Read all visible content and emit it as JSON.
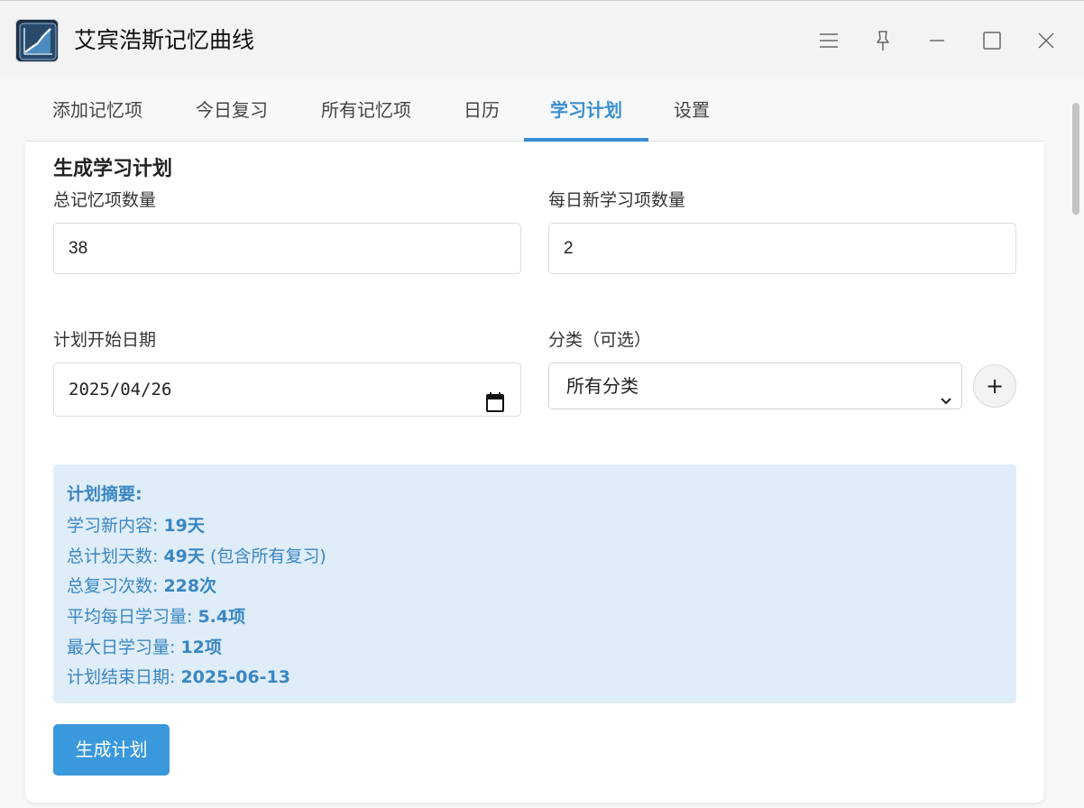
{
  "window": {
    "title": "艾宾浩斯记忆曲线",
    "logo_icon": "memory-curve-app-icon"
  },
  "tabs": [
    {
      "label": "添加记忆项",
      "active": false
    },
    {
      "label": "今日复习",
      "active": false
    },
    {
      "label": "所有记忆项",
      "active": false
    },
    {
      "label": "日历",
      "active": false
    },
    {
      "label": "学习计划",
      "active": true
    },
    {
      "label": "设置",
      "active": false
    }
  ],
  "plan": {
    "title": "生成学习计划",
    "total_items_label": "总记忆项数量",
    "total_items_value": "38",
    "daily_new_label": "每日新学习项数量",
    "daily_new_value": "2",
    "start_date_label": "计划开始日期",
    "start_date_value": "2025/04/26",
    "category_label": "分类（可选）",
    "category_value": "所有分类",
    "add_category_label": "+",
    "generate_label": "生成计划"
  },
  "summary": {
    "title": "计划摘要:",
    "learn_new_label": "学习新内容: ",
    "learn_new_value": "19天",
    "total_days_label": "总计划天数: ",
    "total_days_value": "49天",
    "total_days_note": " (包含所有复习)",
    "total_reviews_label": "总复习次数: ",
    "total_reviews_value": "228次",
    "avg_daily_label": "平均每日学习量: ",
    "avg_daily_value": "5.4项",
    "max_daily_label": "最大日学习量: ",
    "max_daily_value": "12项",
    "end_date_label": "计划结束日期: ",
    "end_date_value": "2025-06-13"
  },
  "colors": {
    "accent": "#3a8fd0",
    "summary_bg": "#dfedf9",
    "summary_text": "#3a86c2",
    "button_bg": "#3a98dc"
  }
}
